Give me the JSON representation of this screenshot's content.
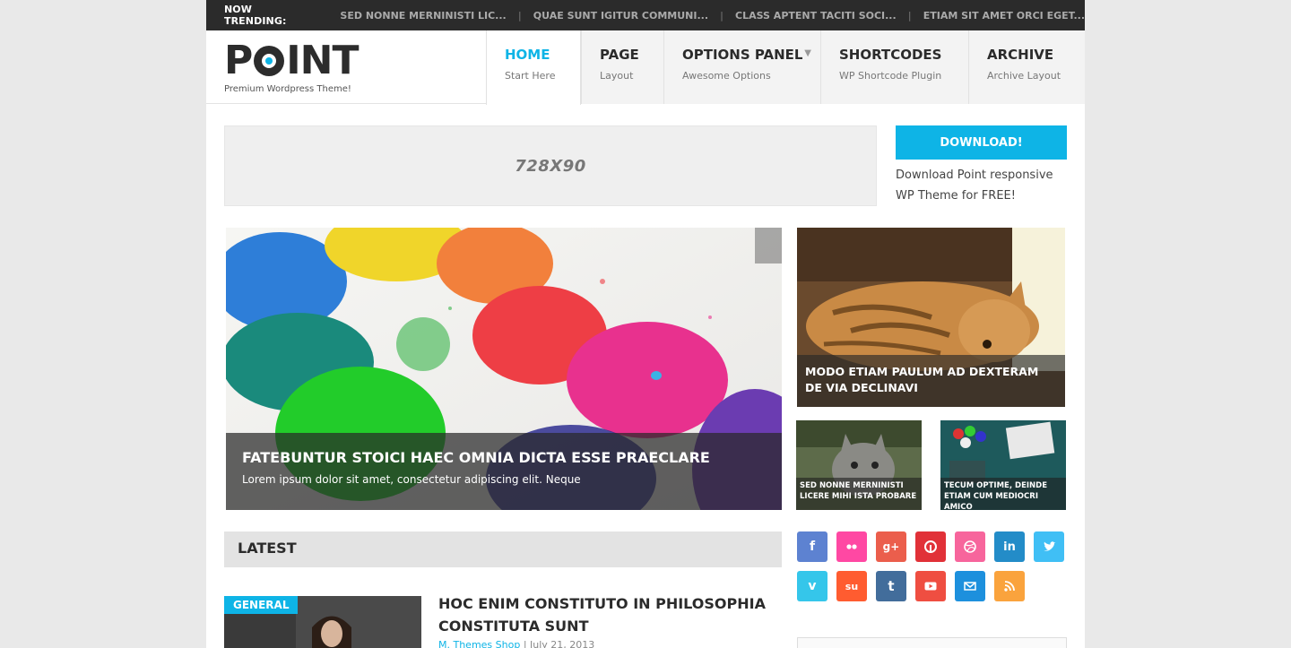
{
  "trending": {
    "label": "NOW TRENDING:",
    "items": [
      "SED NONNE MERNINISTI LIC...",
      "QUAE SUNT IGITUR COMMUNI...",
      "CLASS APTENT TACITI SOCI...",
      "ETIAM SIT AMET ORCI EGET..."
    ]
  },
  "logo": {
    "text_p": "P",
    "text_int": "INT",
    "tagline": "Premium Wordpress Theme!"
  },
  "nav": [
    {
      "title": "HOME",
      "sub": "Start Here"
    },
    {
      "title": "PAGE",
      "sub": "Layout"
    },
    {
      "title": "OPTIONS PANEL",
      "sub": "Awesome Options"
    },
    {
      "title": "SHORTCODES",
      "sub": "WP Shortcode Plugin"
    },
    {
      "title": "ARCHIVE",
      "sub": "Archive Layout"
    }
  ],
  "ad": {
    "label": "728X90"
  },
  "download": {
    "button": "DOWNLOAD!",
    "text": "Download Point responsive WP Theme for FREE!"
  },
  "featured": {
    "main": {
      "title": "FATEBUNTUR STOICI HAEC OMNIA DICTA ESSE PRAECLARE",
      "excerpt": "Lorem ipsum dolor sit amet, consectetur adipiscing elit. Neque"
    },
    "right_top": {
      "title": "MODO ETIAM PAULUM AD DEXTERAM DE VIA DECLINAVI"
    },
    "small_left": {
      "title": "SED NONNE MERNINISTI LICERE MIHI ISTA PROBARE"
    },
    "small_right": {
      "title": "TECUM OPTIME, DEINDE ETIAM CUM MEDIOCRI AMICO"
    }
  },
  "latest": {
    "heading": "LATEST",
    "post": {
      "category": "GENERAL",
      "title": "HOC ENIM CONSTITUTO IN PHILOSOPHIA CONSTITUTA SUNT",
      "author": "M. Themes Shop",
      "date": "| July 21, 2013"
    }
  },
  "social": {
    "colors": {
      "facebook": "#5d82d1",
      "flickr": "#ff48a3",
      "googleplus": "#eb5e4c",
      "pinterest": "#e13138",
      "dribbble": "#f7659c",
      "linkedin": "#238cc8",
      "twitter": "#40bff5",
      "vimeo": "#35c6ea",
      "stumbleupon": "#ff5c30",
      "tumblr": "#426d9b",
      "youtube": "#ef4e41",
      "email": "#1d90dd",
      "rss": "#faa33d"
    }
  },
  "accent": "#0eb4e6"
}
